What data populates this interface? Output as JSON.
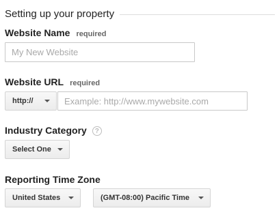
{
  "section": {
    "title": "Setting up your property"
  },
  "website_name": {
    "label": "Website Name",
    "required": "required",
    "placeholder": "My New Website",
    "value": ""
  },
  "website_url": {
    "label": "Website URL",
    "required": "required",
    "protocol": "http://",
    "placeholder": "Example: http://www.mywebsite.com",
    "value": ""
  },
  "industry": {
    "label": "Industry Category",
    "help_icon": "?",
    "selected": "Select One"
  },
  "timezone": {
    "label": "Reporting Time Zone",
    "country": "United States",
    "zone": "(GMT-08:00) Pacific Time"
  },
  "icons": {
    "help": "question-circle-icon",
    "caret": "chevron-down-icon"
  }
}
